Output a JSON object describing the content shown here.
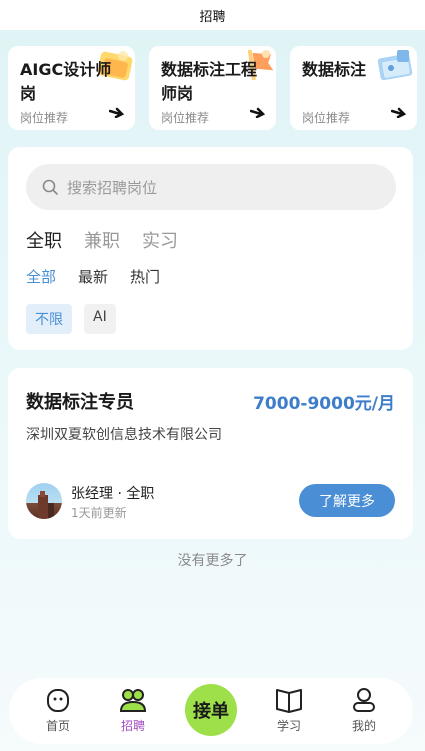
{
  "header": {
    "title": "招聘"
  },
  "recommend": [
    {
      "title": "AIGC设计师岗",
      "subtitle": "岗位推荐"
    },
    {
      "title": "数据标注工程师岗",
      "subtitle": "岗位推荐"
    },
    {
      "title": "数据标注",
      "subtitle": "岗位推荐"
    }
  ],
  "search": {
    "placeholder": "搜索招聘岗位"
  },
  "job_type_tabs": [
    {
      "label": "全职",
      "active": true
    },
    {
      "label": "兼职",
      "active": false
    },
    {
      "label": "实习",
      "active": false
    }
  ],
  "sort_tabs": [
    {
      "label": "全部",
      "active": true
    },
    {
      "label": "最新",
      "active": false
    },
    {
      "label": "热门",
      "active": false
    }
  ],
  "chips": [
    {
      "label": "不限",
      "active": true
    },
    {
      "label": "AI",
      "active": false
    }
  ],
  "job": {
    "title": "数据标注专员",
    "salary": "7000-9000元/月",
    "company": "深圳双夏软创信息技术有限公司",
    "recruiter": "张经理 · 全职",
    "updated": "1天前更新",
    "more_label": "了解更多"
  },
  "list_end": "没有更多了",
  "tabbar": {
    "home": "首页",
    "recruit": "招聘",
    "center": "接单",
    "study": "学习",
    "mine": "我的"
  },
  "colors": {
    "accent": "#4a8fd6",
    "center_button": "#9ee04a",
    "active_tab": "#a04bc0"
  }
}
